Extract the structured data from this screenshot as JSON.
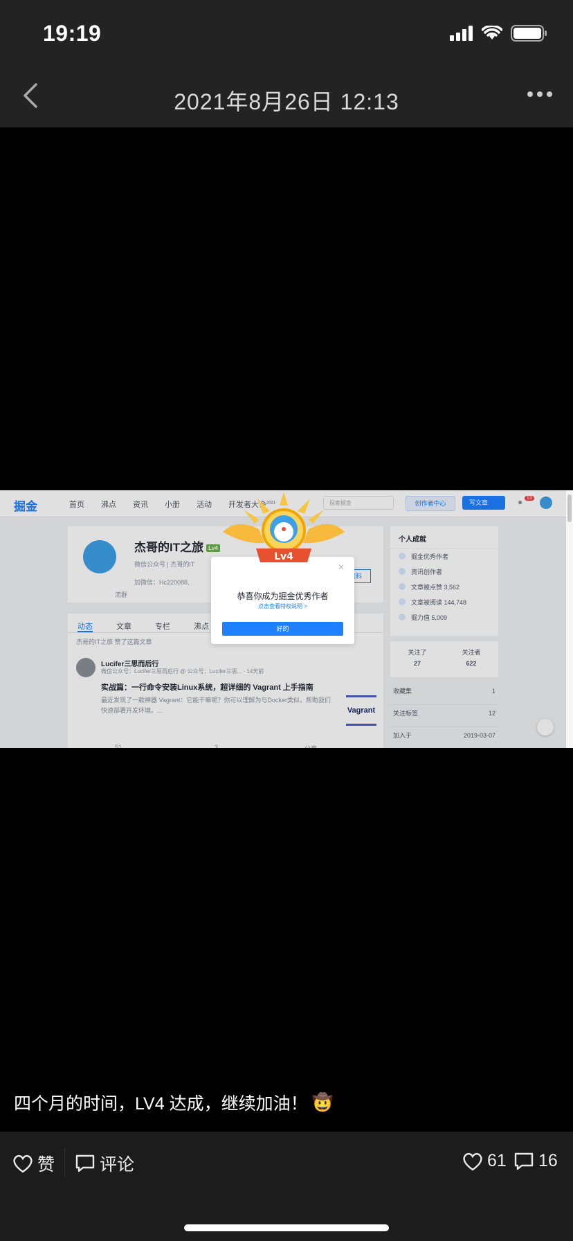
{
  "status_bar": {
    "time": "19:19"
  },
  "nav": {
    "title": "2021年8月26日 12:13"
  },
  "screenshot": {
    "logo": "掘金",
    "nav_items": [
      "首页",
      "沸点",
      "资讯",
      "小册",
      "活动"
    ],
    "dev_conf": "开发者大会",
    "dev_conf_year": "2021",
    "search_placeholder": "探索掘金",
    "creator_center": "创作者中心",
    "write_button": "写文章",
    "bell_badge": "13",
    "profile": {
      "name": "杰哥的IT之旅",
      "level": "Lv4",
      "line1": "微信公众号 | 杰哥的IT",
      "line2": "加微信：Hc220088,",
      "line3": "流群",
      "edit_label": "资料"
    },
    "tabs": [
      "动态",
      "文章",
      "专栏",
      "沸点"
    ],
    "feed_head": "杰哥的IT之旅 赞了这篇文章",
    "post": {
      "author": "Lucifer三思而后行",
      "meta": "微信公众号：Lucifer三思而后行 @ 公众号：Lucifer三思... · 14天前",
      "title": "实战篇：一行命令安装Linux系统，超详细的 Vagrant 上手指南",
      "desc": "最近发现了一款神器 Vagrant：它能干嘛呢？你可以理解为与Docker类似，帮助我们快速部署开发环境。...",
      "thumb": "Vagrant",
      "likes": "51",
      "comments": "3",
      "views": "分享"
    },
    "side": {
      "title": "个人成就",
      "items": [
        "掘金优秀作者",
        "资讯创作者",
        "文章被点赞 3,562",
        "文章被阅读 144,748",
        "掘力值 5,009"
      ],
      "following_label": "关注了",
      "following": "27",
      "followers_label": "关注者",
      "followers": "622",
      "rows": [
        {
          "label": "收藏集",
          "value": "1"
        },
        {
          "label": "关注标签",
          "value": "12"
        },
        {
          "label": "加入于",
          "value": "2019-03-07"
        }
      ]
    },
    "modal": {
      "badge": "Lv4",
      "title": "恭喜你成为掘金优秀作者",
      "link": "点击查看特权说明 >",
      "ok": "好的"
    }
  },
  "caption": {
    "text": "四个月的时间，LV4 达成，继续加油！",
    "emoji": "🤠"
  },
  "bottom": {
    "like_label": "赞",
    "comment_label": "评论",
    "like_count": "61",
    "comment_count": "16"
  },
  "colors": {
    "accent": "#1e80ff",
    "bar_bg": "#232323",
    "bottom_bg": "#1c1c1c"
  }
}
